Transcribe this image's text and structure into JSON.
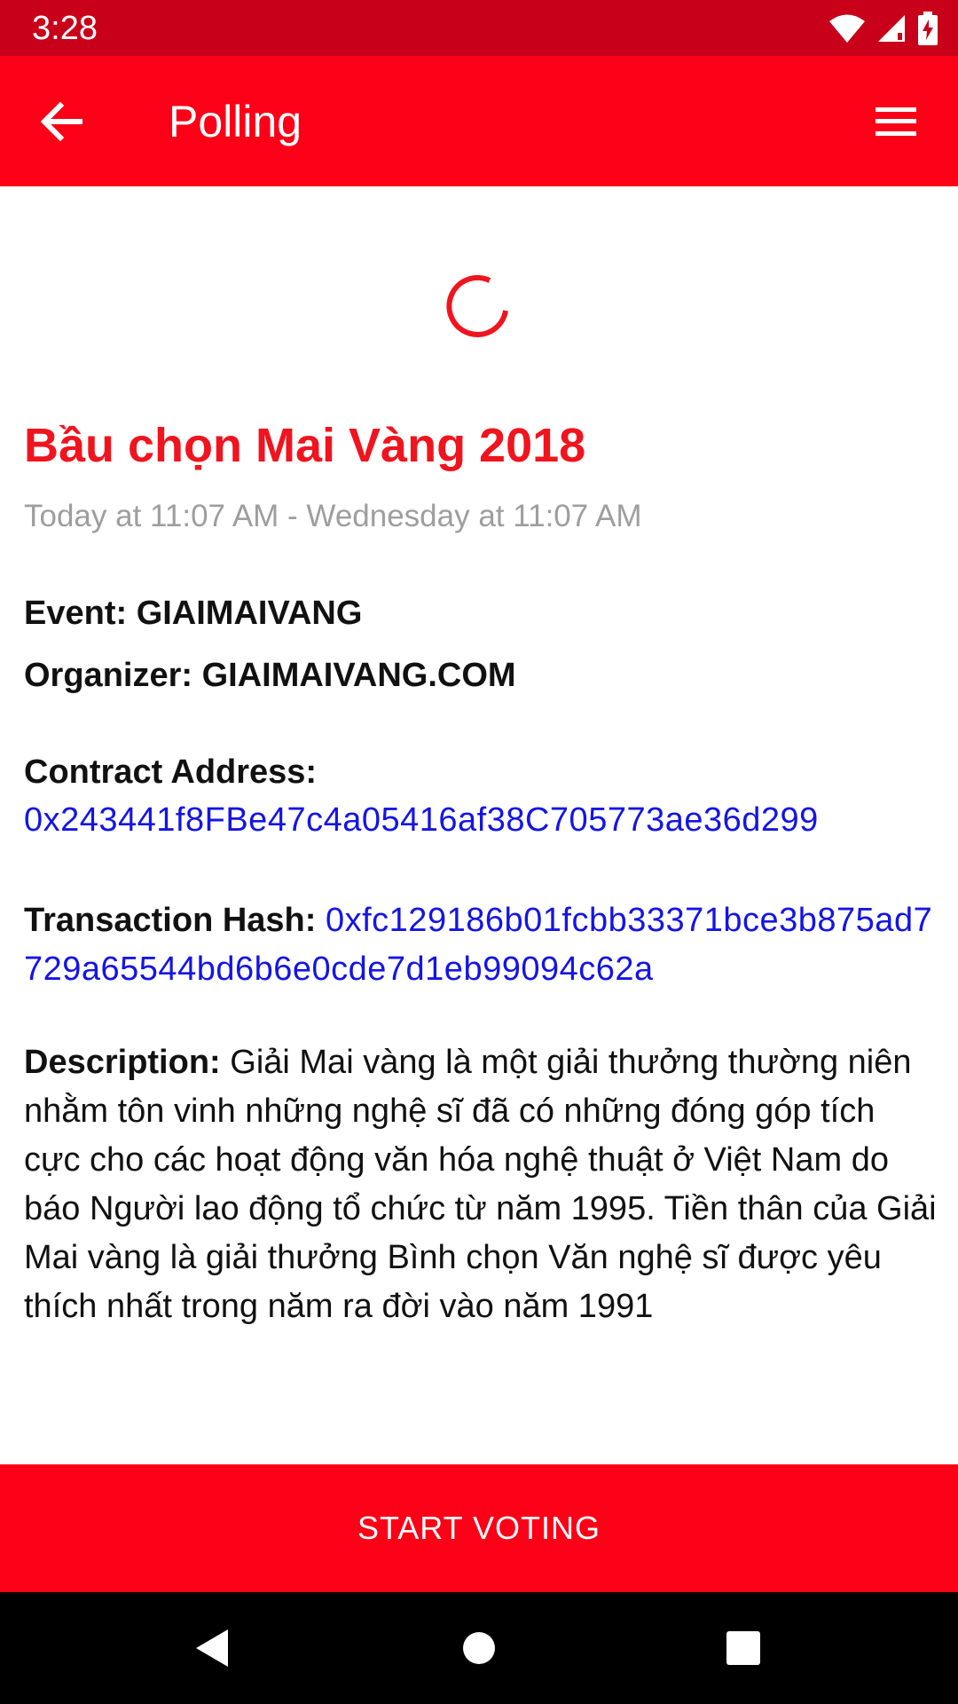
{
  "status_bar": {
    "time": "3:28",
    "icons": [
      "wifi-icon",
      "cell-signal-icon",
      "battery-charging-icon"
    ]
  },
  "app_bar": {
    "title": "Polling",
    "back_icon": "arrow-left-icon",
    "menu_icon": "hamburger-menu-icon",
    "color": "#fb0016"
  },
  "loading": {
    "icon": "spinner-icon",
    "color": "#f0141e"
  },
  "poll": {
    "title": "Bầu chọn Mai Vàng 2018",
    "time_range": "Today at 11:07 AM - Wednesday at 11:07 AM",
    "event": "Event: GIAIMAIVANG",
    "organizer": "Organizer: GIAIMAIVANG.COM",
    "contract_label": "Contract Address:",
    "contract_address": "0x243441f8FBe47c4a05416af38C705773ae36d299",
    "tx_label": "Transaction Hash:",
    "tx_hash": "0xfc129186b01fcbb33371bce3b875ad7729a65544bd6b6e0cde7d1eb99094c62a",
    "description_label": "Description:",
    "description": "Giải Mai vàng là một giải thưởng thường niên nhằm tôn vinh những nghệ sĩ đã có những đóng góp tích cực cho các hoạt động văn hóa nghệ thuật ở Việt Nam do báo Người lao động tổ chức từ năm 1995. Tiền thân của Giải Mai vàng là giải thưởng Bình chọn Văn nghệ sĩ được yêu thích nhất trong năm ra đời vào năm 1991"
  },
  "actions": {
    "start_voting": "START VOTING"
  },
  "nav_bar": {
    "icons": [
      "back-triangle-icon",
      "home-circle-icon",
      "recents-square-icon"
    ]
  },
  "colors": {
    "accent": "#fb0016",
    "status_bar": "#c8001a",
    "link": "#1414e6",
    "muted": "#9e9e9e"
  }
}
